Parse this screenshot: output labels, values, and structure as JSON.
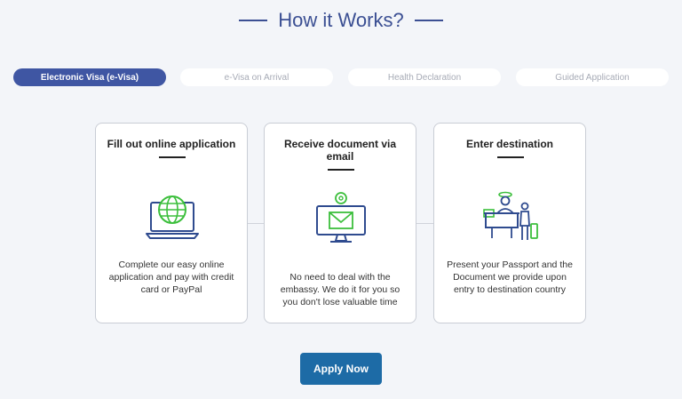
{
  "section_title": "How it Works?",
  "tabs": [
    {
      "label": "Electronic Visa (e-Visa)",
      "active": true
    },
    {
      "label": "e-Visa on Arrival",
      "active": false
    },
    {
      "label": "Health Declaration",
      "active": false
    },
    {
      "label": "Guided Application",
      "active": false
    }
  ],
  "steps": [
    {
      "title": "Fill out online application",
      "icon": "laptop-globe-icon",
      "text": "Complete our easy online application and pay with credit card or PayPal"
    },
    {
      "title": "Receive document via email",
      "icon": "monitor-email-icon",
      "text": "No need to deal with the embassy. We do it for you so you don't lose valuable time"
    },
    {
      "title": "Enter destination",
      "icon": "passport-control-icon",
      "text": "Present your Passport and the Document we provide upon entry to destination country"
    }
  ],
  "cta": {
    "label": "Apply Now"
  },
  "colors": {
    "primary": "#3f56a3",
    "icon_blue": "#2f4b8f",
    "icon_green": "#3cbf3c",
    "button": "#1d6ba6"
  }
}
